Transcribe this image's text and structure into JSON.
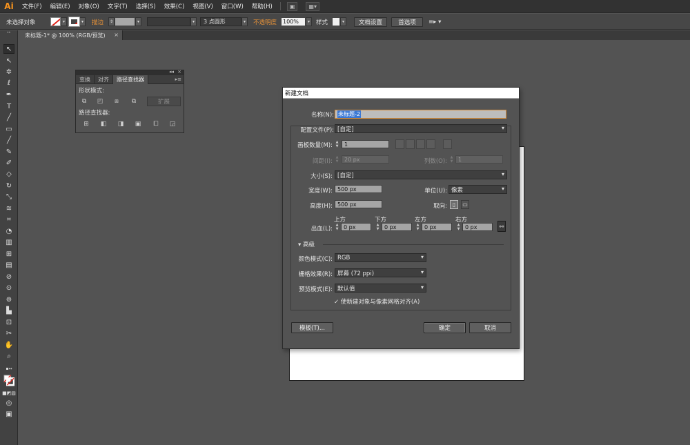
{
  "app": {
    "logo": "Ai"
  },
  "menu": [
    "文件(F)",
    "编辑(E)",
    "对象(O)",
    "文字(T)",
    "选择(S)",
    "效果(C)",
    "视图(V)",
    "窗口(W)",
    "帮助(H)"
  ],
  "control_bar": {
    "selection_status": "未选择对象",
    "stroke_label": "描边",
    "brush_value": "3 点圆形",
    "opacity_label": "不透明度",
    "opacity_value": "100%",
    "style_label": "样式",
    "doc_setup": "文档设置",
    "preferences": "首选项"
  },
  "document_tab": {
    "title": "未标题-1* @ 100% (RGB/预览)",
    "close": "×"
  },
  "pathfinder_panel": {
    "tabs": [
      "变换",
      "对齐",
      "路径查找器"
    ],
    "shape_modes_label": "形状模式:",
    "pathfinders_label": "路径查找器:",
    "expand_button": "扩展"
  },
  "new_document_dialog": {
    "title": "新建文档",
    "name_label": "名称(N):",
    "name_value": "未标题-2",
    "profile_label": "配置文件(P):",
    "profile_value": "[自定]",
    "artboards_label": "画板数量(M):",
    "artboards_value": "1",
    "spacing_label": "间距(I):",
    "spacing_value": "20 px",
    "columns_label": "列数(O):",
    "columns_value": "1",
    "size_label": "大小(S):",
    "size_value": "[自定]",
    "width_label": "宽度(W):",
    "width_value": "500 px",
    "units_label": "单位(U):",
    "units_value": "像素",
    "height_label": "高度(H):",
    "height_value": "500 px",
    "orientation_label": "取向:",
    "bleed_label": "出血(L):",
    "bleed_top_label": "上方",
    "bleed_bottom_label": "下方",
    "bleed_left_label": "左方",
    "bleed_right_label": "右方",
    "bleed_top": "0 px",
    "bleed_bottom": "0 px",
    "bleed_left": "0 px",
    "bleed_right": "0 px",
    "advanced_label": "高级",
    "color_mode_label": "颜色模式(C):",
    "color_mode_value": "RGB",
    "raster_label": "栅格效果(R):",
    "raster_value": "屏幕 (72 ppi)",
    "preview_label": "预览模式(E):",
    "preview_value": "默认值",
    "align_pixel_grid": "使新建对象与像素网格对齐(A)",
    "align_pixel_grid_checked": true,
    "templates_button": "模板(T)...",
    "ok_button": "确定",
    "cancel_button": "取消"
  }
}
